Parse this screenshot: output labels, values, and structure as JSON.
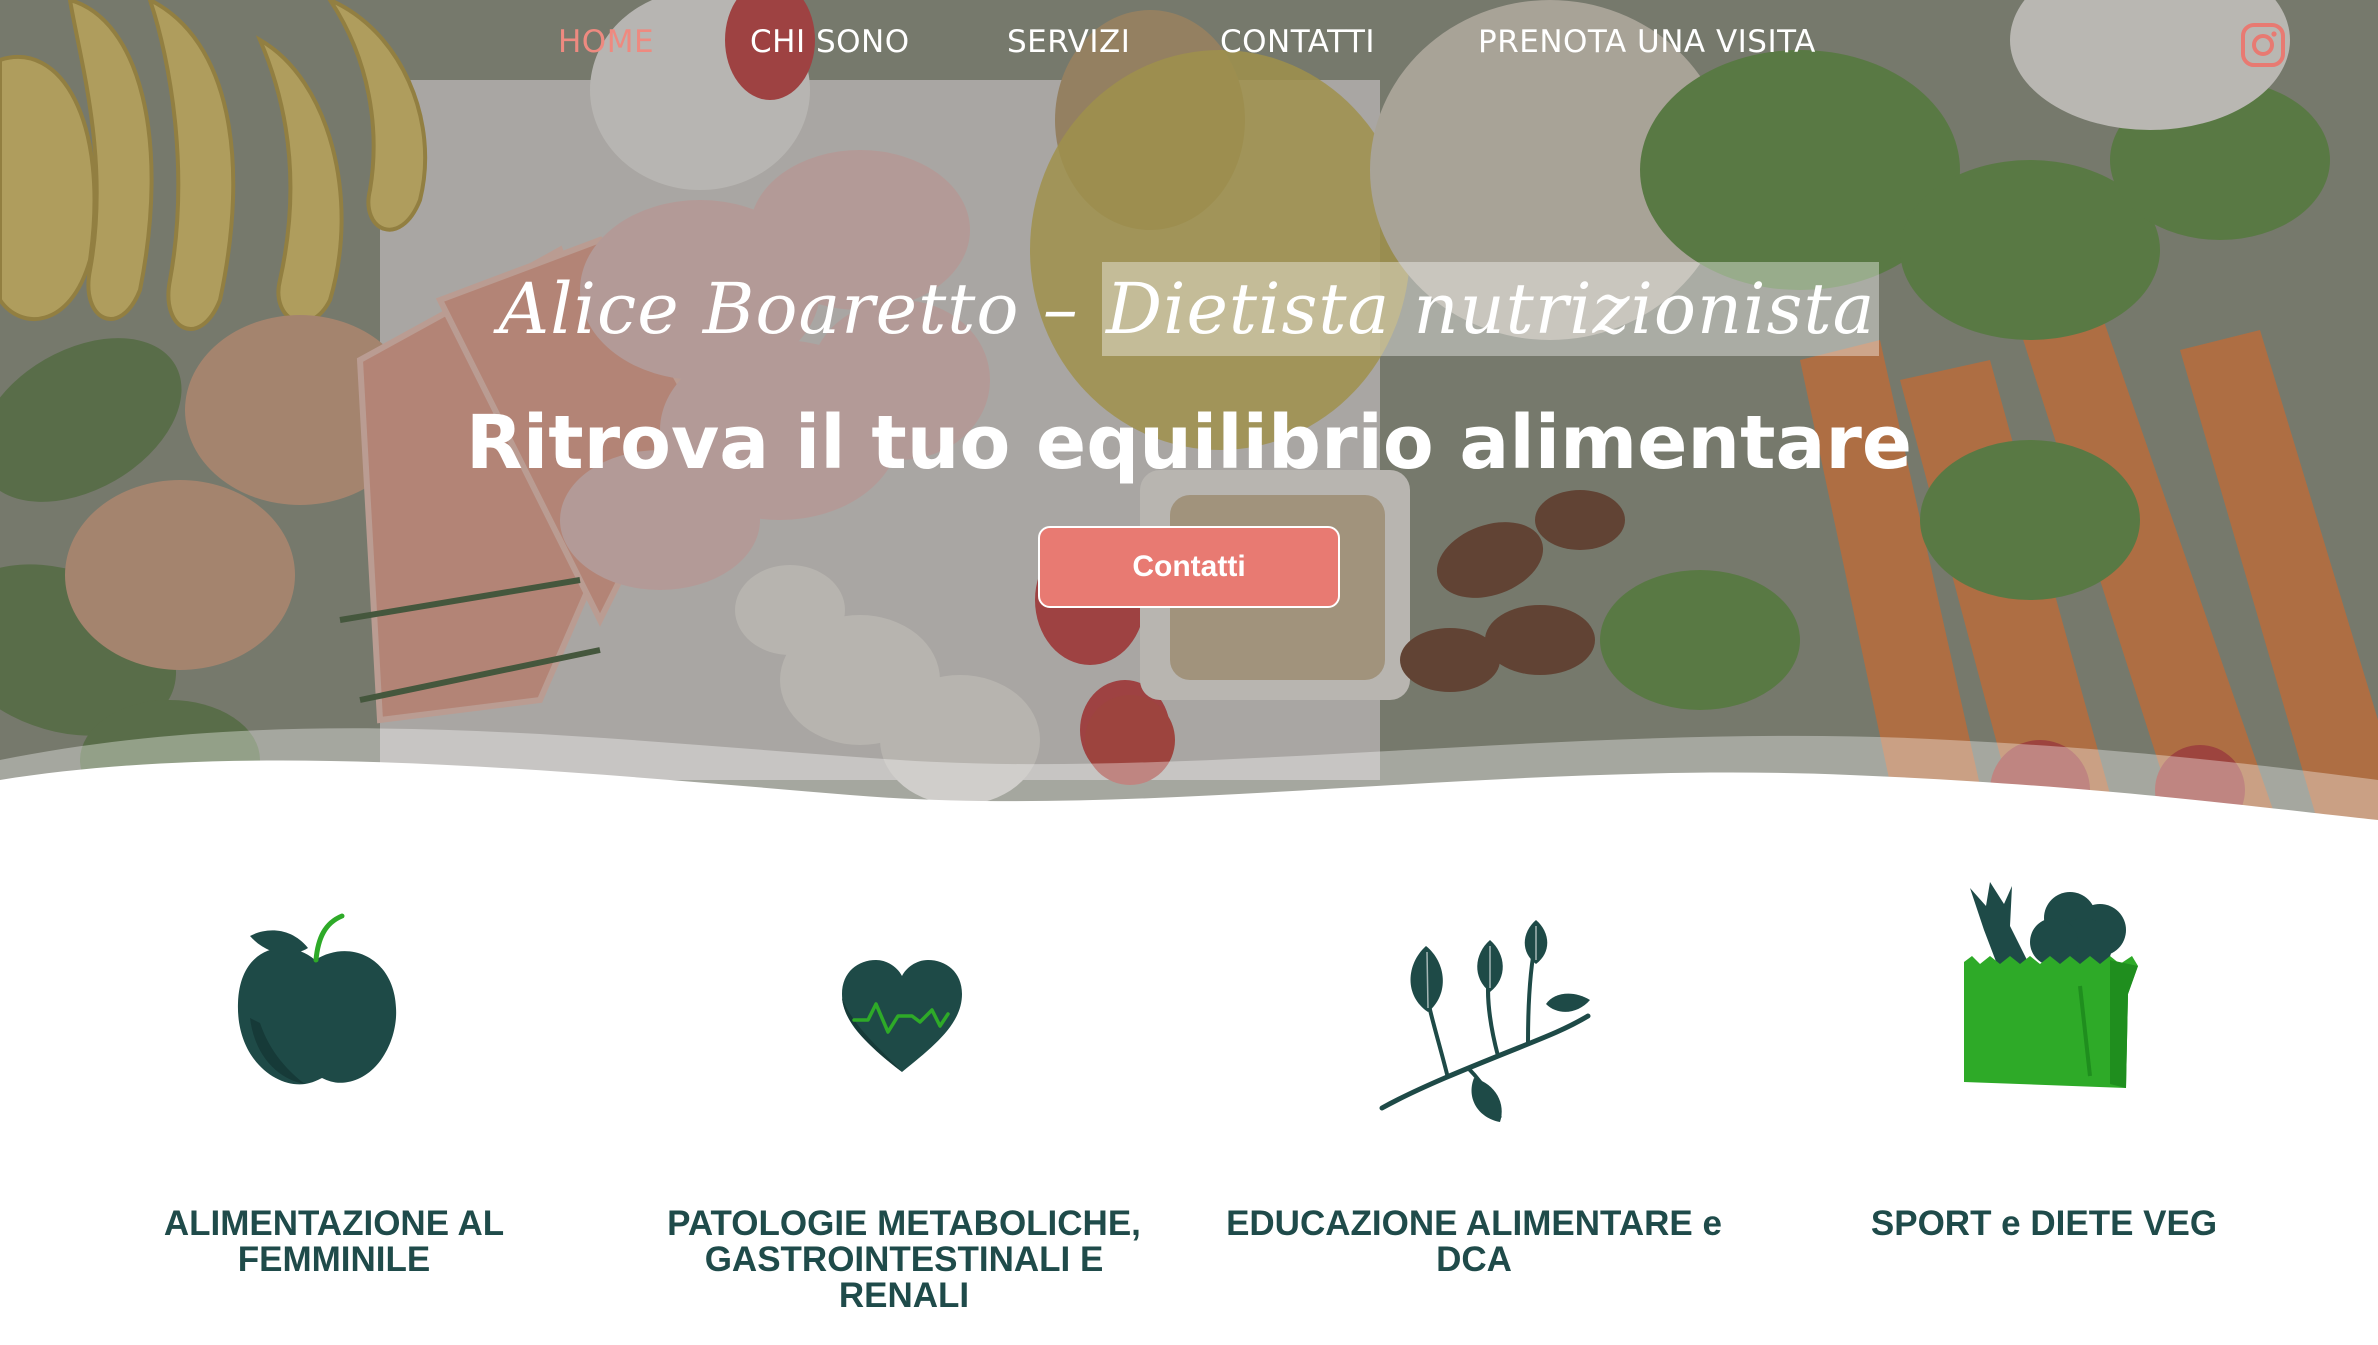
{
  "nav": {
    "items": [
      {
        "label": "HOME",
        "active": true
      },
      {
        "label": "CHI SONO",
        "active": false
      },
      {
        "label": "SERVIZI",
        "active": false
      },
      {
        "label": "CONTATTI",
        "active": false
      },
      {
        "label": "PRENOTA UNA VISITA",
        "active": false
      }
    ],
    "social_icon": "instagram-icon"
  },
  "hero": {
    "subtitle_name": "Alice Boaretto – ",
    "subtitle_role": "Dietista nutrizionista",
    "title": "Ritrova il tuo equilibrio alimentare",
    "cta_label": "Contatti"
  },
  "services": [
    {
      "icon": "apple-icon",
      "label": "ALIMENTAZIONE AL FEMMINILE"
    },
    {
      "icon": "heart-pulse-icon",
      "label": "PATOLOGIE METABOLICHE, GASTROINTESTINALI E RENALI"
    },
    {
      "icon": "leaf-branch-icon",
      "label": "EDUCAZIONE ALIMENTARE e DCA"
    },
    {
      "icon": "grocery-bag-icon",
      "label": "SPORT e DIETE VEG"
    }
  ],
  "colors": {
    "accent": "#e87a72",
    "nav_active": "#ee8a80",
    "heading_dark": "#1f4b4a",
    "icon_dark": "#1e4a47",
    "icon_green": "#2eaa28"
  }
}
